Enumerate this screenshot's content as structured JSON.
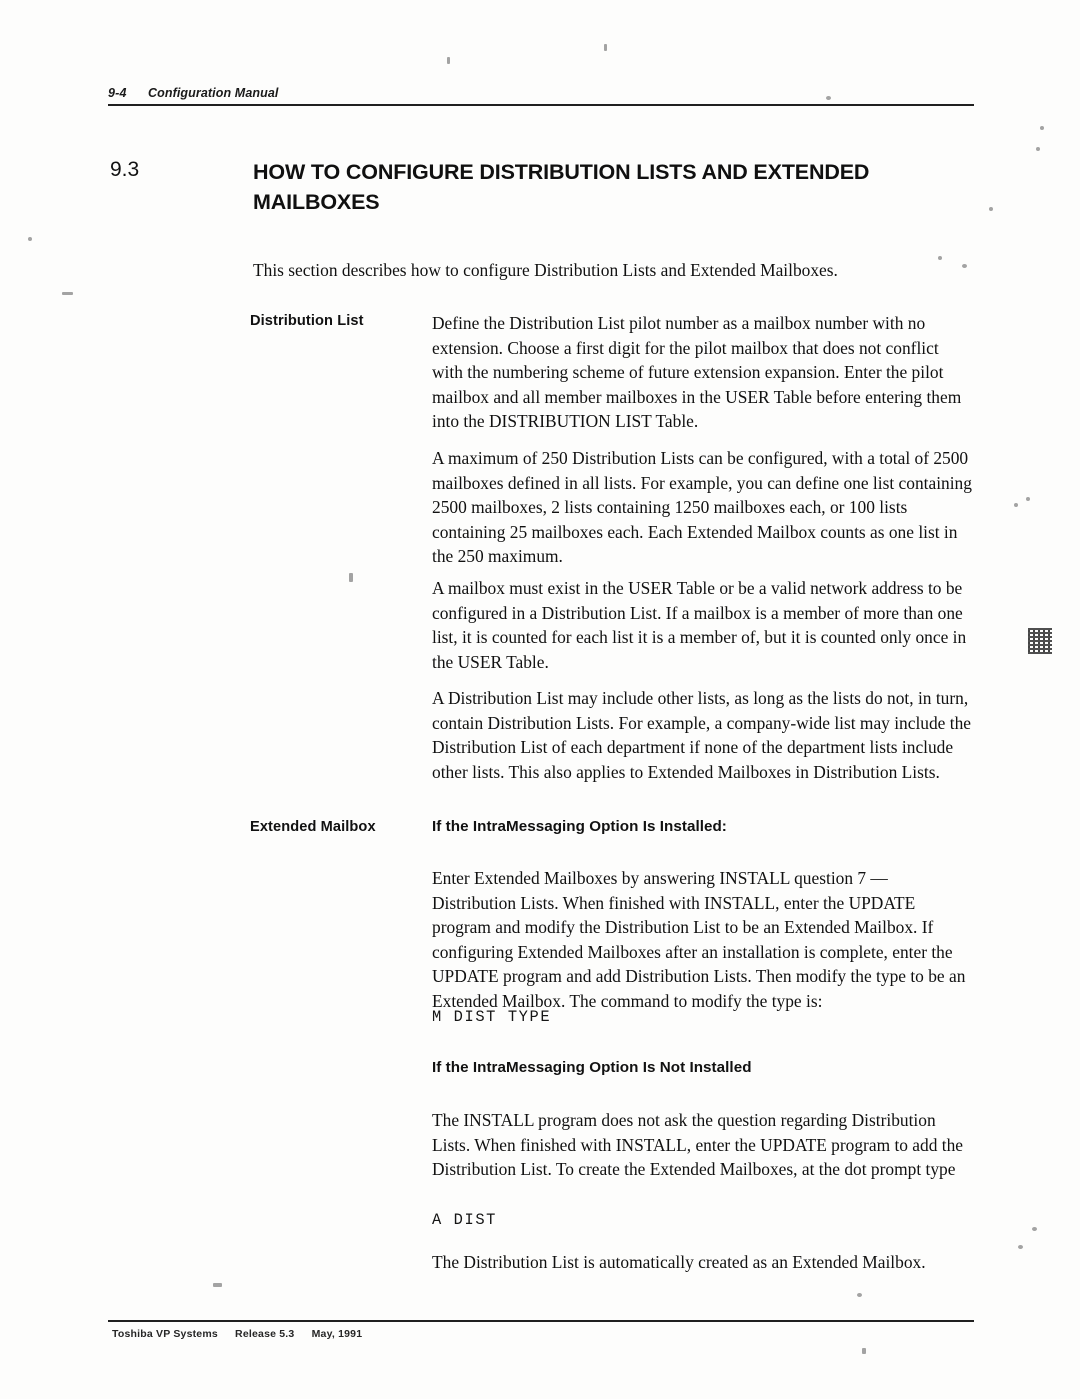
{
  "header": {
    "folio": "9-4",
    "manual_title": "Configuration Manual"
  },
  "section": {
    "number": "9.3",
    "title": "HOW TO CONFIGURE DISTRIBUTION LISTS AND EXTENDED MAILBOXES"
  },
  "intro": "This section describes how to configure Distribution Lists and Extended Mailboxes.",
  "terms": {
    "distribution_list": "Distribution List",
    "extended_mailbox": "Extended Mailbox"
  },
  "distribution_list_paragraphs": [
    "Define the Distribution List pilot number as a mailbox number with no extension. Choose a first digit for the pilot mailbox that does not conflict with the numbering scheme of future extension expansion.  Enter the pilot mailbox and all member mailboxes in the USER Table before entering them into the DISTRIBUTION LIST Table.",
    "A maximum of 250 Distribution Lists can be configured, with a total of 2500 mailboxes defined in all lists. For example, you can define one list containing 2500 mailboxes, 2 lists containing 1250 mailboxes each, or 100 lists containing 25 mailboxes each. Each Extended Mailbox counts as one list in the 250 maximum.",
    "A mailbox must exist in the USER Table or be a valid network address to be configured in a Distribution List.  If a mailbox is a member of more than one list, it is counted for each list it is a member of, but it is counted only once in the USER Table.",
    "A Distribution List may include other lists, as long as the lists do not, in turn, contain Distribution Lists.  For example, a company-wide list may include the Distribution List of each department if none of the department lists include other lists. This also applies to Extended Mailboxes in Distribution Lists."
  ],
  "extended_mailbox": {
    "subhead_installed": "If the IntraMessaging Option Is Installed:",
    "paragraph_installed": "Enter Extended Mailboxes by answering INSTALL question 7 — Distribution Lists. When finished with INSTALL, enter the UPDATE program and modify the Distribution List to be an Extended Mailbox. If configuring Extended Mailboxes after an installation is complete, enter the UPDATE program and add Distribution Lists.  Then modify the type to be an Extended Mailbox. The command to modify the type is:",
    "command_modify": "M DIST TYPE",
    "subhead_not_installed": "If the IntraMessaging Option Is Not Installed",
    "paragraph_not_installed": "The INSTALL program does not ask the question regarding Distribution Lists. When finished with INSTALL, enter the UPDATE program to add the Distribution List. To create the Extended Mailboxes, at the dot prompt type",
    "command_add": "A DIST",
    "closing_paragraph": "The Distribution List is automatically created as an Extended Mailbox."
  },
  "footer": {
    "company": "Toshiba VP Systems",
    "release": "Release 5.3",
    "date": "May, 1991"
  }
}
